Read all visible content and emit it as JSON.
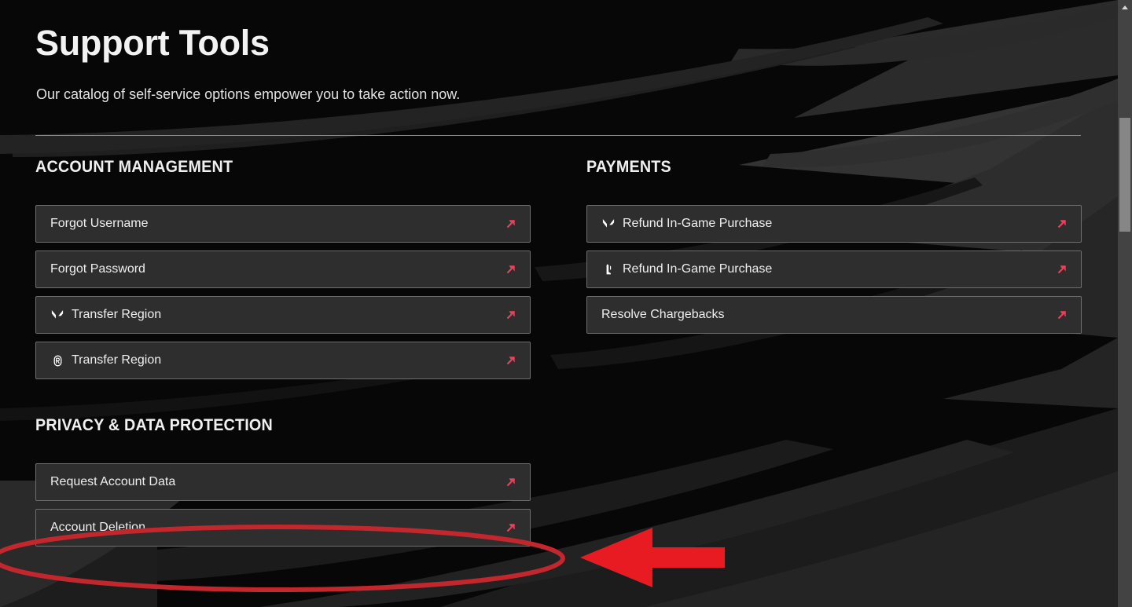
{
  "page": {
    "title": "Support Tools",
    "subtitle": "Our catalog of self-service options empower you to take action now."
  },
  "colors": {
    "accent_red": "#e8435c",
    "annotation_red": "#e81b23",
    "annotation_ellipse": "#c1272d",
    "card_bg": "#2e2e2e",
    "card_border": "#6e6e6e",
    "page_bg": "#050505",
    "text": "#efefef"
  },
  "sections": {
    "account_management": {
      "title": "ACCOUNT MANAGEMENT",
      "items": [
        {
          "label": "Forgot Username",
          "icon": "",
          "arrow": "external-link-arrow-icon"
        },
        {
          "label": "Forgot Password",
          "icon": "",
          "arrow": "external-link-arrow-icon"
        },
        {
          "label": "Transfer Region",
          "icon": "valorant-logo-icon",
          "arrow": "external-link-arrow-icon"
        },
        {
          "label": "Transfer Region",
          "icon": "riot-game-badge-icon",
          "arrow": "external-link-arrow-icon"
        }
      ]
    },
    "privacy_data_protection": {
      "title": "PRIVACY & DATA PROTECTION",
      "items": [
        {
          "label": "Request Account Data",
          "icon": "",
          "arrow": "external-link-arrow-icon"
        },
        {
          "label": "Account Deletion",
          "icon": "",
          "arrow": "external-link-arrow-icon"
        }
      ]
    },
    "payments": {
      "title": "PAYMENTS",
      "items": [
        {
          "label": "Refund In-Game Purchase",
          "icon": "valorant-logo-icon",
          "arrow": "external-link-arrow-icon"
        },
        {
          "label": "Refund In-Game Purchase",
          "icon": "league-of-legends-logo-icon",
          "arrow": "external-link-arrow-icon"
        },
        {
          "label": "Resolve Chargebacks",
          "icon": "",
          "arrow": "external-link-arrow-icon"
        }
      ]
    }
  },
  "scrollbar": {
    "up_arrow": "scroll-up-arrow-icon",
    "thumb": "scrollbar-thumb"
  },
  "annotations": {
    "ellipse_target": "Account Deletion",
    "arrow_direction": "points-left-at-account-deletion"
  }
}
